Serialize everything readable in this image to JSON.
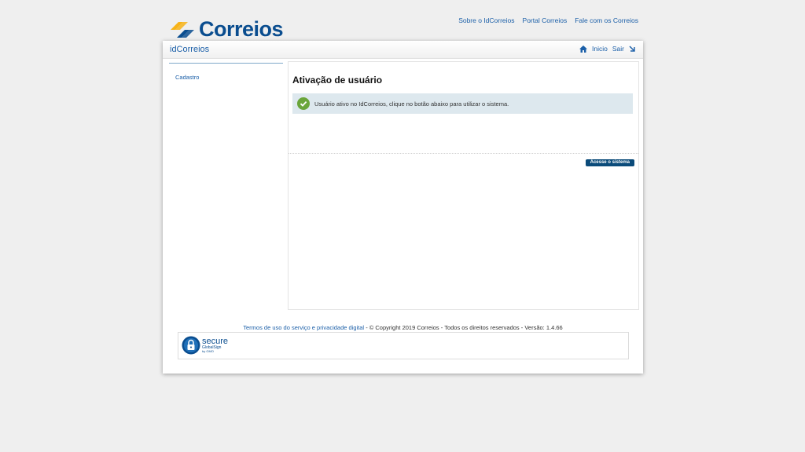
{
  "header": {
    "logo_text": "Correios",
    "links": [
      "Sobre o IdCorreios",
      "Portal Correios",
      "Fale com os Correios"
    ]
  },
  "titlebar": {
    "app_title": "idCorreios",
    "home_label": "Inicio",
    "logout_label": "Sair"
  },
  "sidebar": {
    "items": [
      {
        "label": "Cadastro"
      }
    ]
  },
  "content": {
    "title": "Ativação de usuário",
    "message": "Usuário ativo no IdCorreios, clique no botão abaixo para utilizar o sistema.",
    "button_label": "Acesse o sistema"
  },
  "footer": {
    "terms_link": "Termos de uso do serviço e privacidade digital",
    "copyright": " - © Copyright 2019 Correios - Todos os direitos reservados - Versão: 1.4.66",
    "seal_main": "secure",
    "seal_sub": "GlobalSign",
    "seal_sub2": "by GMO"
  },
  "colors": {
    "brand_blue": "#0a4d8f",
    "brand_yellow": "#f7b318",
    "link_blue": "#1b5fa8",
    "success_green": "#6aa53a",
    "message_bg": "#dde8ee",
    "button_bg": "#0b4b7a"
  }
}
